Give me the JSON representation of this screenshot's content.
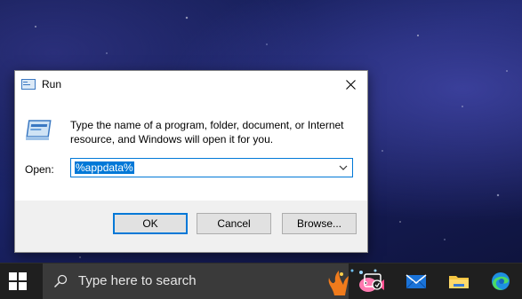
{
  "dialog": {
    "title": "Run",
    "description": "Type the name of a program, folder, document, or Internet resource, and Windows will open it for you.",
    "open_label": "Open:",
    "open_value": "%appdata%",
    "buttons": {
      "ok": "OK",
      "cancel": "Cancel",
      "browse": "Browse..."
    }
  },
  "taskbar": {
    "search_placeholder": "Type here to search",
    "icons": [
      "windows-start-icon",
      "search-icon",
      "search-highlight-icon",
      "task-view-icon",
      "mail-icon",
      "file-explorer-icon",
      "edge-icon"
    ]
  },
  "colors": {
    "accent": "#0078d7",
    "taskbar": "#1f1f1f",
    "footer": "#f0f0f0"
  }
}
